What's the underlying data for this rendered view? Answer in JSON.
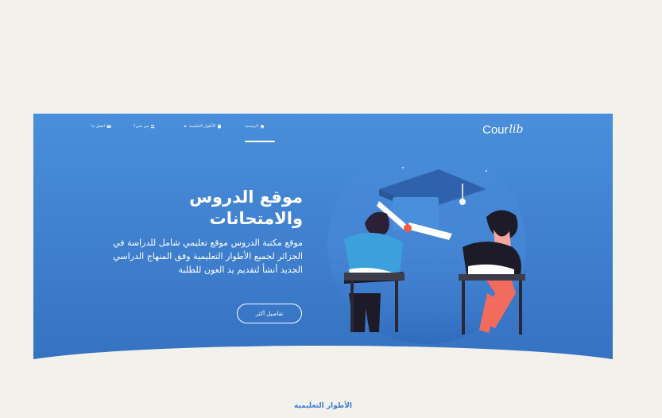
{
  "brand": {
    "logo_main": "Cour",
    "logo_script": "lib"
  },
  "nav": {
    "items": [
      {
        "label": "الرئيسية",
        "icon": "home-icon",
        "active": true
      },
      {
        "label": "الأطوار التعليمية",
        "icon": "book-icon",
        "has_dropdown": true
      },
      {
        "label": "من نحن؟",
        "icon": "users-icon"
      },
      {
        "label": "اتصل بنا",
        "icon": "envelope-icon"
      }
    ]
  },
  "hero": {
    "title": "موقع الدروس والامتحانات",
    "description": "موقع مكتبة الدروس موقع تعليمي شامل للدراسة في الجزائر لجميع الأطوار التعليمية وفق المنهاج الدراسي الجديد أنشأ لتقديم يد العون للطلبة",
    "button_label": "تفاصيل أكثر",
    "illustration": "students-exam-illustration"
  },
  "section": {
    "title": "الأطوار التعليمية"
  },
  "colors": {
    "hero_top": "#4a8fdb",
    "hero_bottom": "#3571c0",
    "page_bg": "#f3f1ec",
    "accent": "#3b7dd3"
  }
}
